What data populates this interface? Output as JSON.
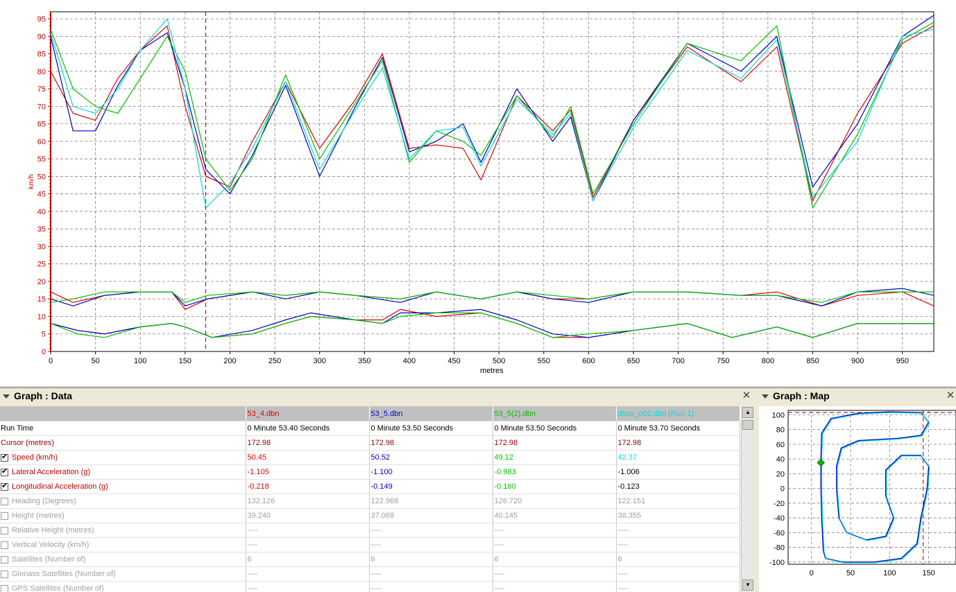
{
  "chart_data": {
    "type": "line",
    "xlabel": "metres",
    "ylabel": "km/h",
    "xlim": [
      0,
      985
    ],
    "ylim": [
      0,
      97
    ],
    "xticks": [
      0,
      50,
      100,
      150,
      200,
      250,
      300,
      350,
      400,
      450,
      500,
      550,
      600,
      650,
      700,
      750,
      800,
      850,
      900,
      950
    ],
    "yticks": [
      0,
      5,
      10,
      15,
      20,
      25,
      30,
      35,
      40,
      45,
      50,
      55,
      60,
      65,
      70,
      75,
      80,
      85,
      90,
      95
    ],
    "cursor_x": 173,
    "grid": true,
    "series": [
      {
        "name": "53_4.dbn",
        "color": "#e00000",
        "x": [
          0,
          25,
          50,
          75,
          100,
          130,
          150,
          173,
          200,
          225,
          262,
          300,
          340,
          370,
          400,
          430,
          460,
          480,
          520,
          560,
          580,
          605,
          650,
          710,
          770,
          810,
          850,
          900,
          950,
          985
        ],
        "y": [
          80,
          68,
          66,
          78,
          86,
          93,
          70,
          50,
          47,
          60,
          77,
          58,
          72,
          85,
          58,
          59,
          58,
          49,
          73,
          63,
          69,
          44,
          66,
          87,
          77,
          87,
          43,
          68,
          88,
          93
        ]
      },
      {
        "name": "53_5.dbn",
        "color": "#0000c0",
        "x": [
          0,
          25,
          50,
          75,
          100,
          130,
          150,
          173,
          200,
          225,
          262,
          300,
          340,
          370,
          400,
          430,
          460,
          480,
          520,
          560,
          580,
          605,
          650,
          710,
          770,
          810,
          850,
          900,
          950,
          985
        ],
        "y": [
          90,
          63,
          63,
          76,
          86,
          91,
          75,
          52,
          45,
          56,
          76,
          50,
          70,
          84,
          57,
          60,
          65,
          54,
          75,
          60,
          67,
          43,
          66,
          88,
          80,
          90,
          47,
          65,
          90,
          96
        ]
      },
      {
        "name": "53_5(2).dbn",
        "color": "#00c000",
        "x": [
          0,
          25,
          50,
          75,
          100,
          130,
          150,
          173,
          200,
          225,
          262,
          300,
          340,
          370,
          400,
          430,
          460,
          480,
          520,
          560,
          580,
          605,
          650,
          710,
          770,
          810,
          850,
          900,
          950,
          985
        ],
        "y": [
          92,
          75,
          70,
          68,
          78,
          90,
          80,
          55,
          46,
          55,
          79,
          55,
          71,
          83,
          54,
          63,
          60,
          56,
          73,
          61,
          70,
          45,
          65,
          88,
          83,
          93,
          41,
          62,
          89,
          94
        ]
      },
      {
        "name": "dbox_001.dbn (Run 1)",
        "color": "#00dcdc",
        "x": [
          0,
          25,
          50,
          75,
          100,
          130,
          150,
          173,
          200,
          225,
          262,
          300,
          340,
          370,
          400,
          430,
          460,
          480,
          520,
          560,
          580,
          605,
          650,
          710,
          770,
          810,
          850,
          900,
          950,
          985
        ],
        "y": [
          91,
          70,
          68,
          75,
          86,
          95,
          75,
          41,
          48,
          58,
          77,
          52,
          69,
          81,
          55,
          63,
          64,
          53,
          72,
          62,
          68,
          43,
          64,
          86,
          78,
          89,
          44,
          60,
          90,
          92
        ]
      },
      {
        "name": "53_4.dbn",
        "color": "#e00000",
        "x": [
          0,
          25,
          60,
          100,
          135,
          150,
          175,
          225,
          262,
          300,
          340,
          390,
          430,
          480,
          520,
          560,
          600,
          650,
          710,
          770,
          810,
          860,
          900,
          950,
          985
        ],
        "y": [
          17,
          14,
          16,
          17,
          17,
          12,
          15,
          17,
          16,
          17,
          16,
          15,
          17,
          15,
          17,
          15,
          15,
          17,
          17,
          16,
          17,
          13,
          16,
          17,
          13
        ]
      },
      {
        "name": "53_5.dbn",
        "color": "#0000c0",
        "x": [
          0,
          25,
          60,
          100,
          135,
          150,
          175,
          225,
          262,
          300,
          340,
          390,
          430,
          480,
          520,
          560,
          600,
          650,
          710,
          770,
          810,
          860,
          900,
          950,
          985
        ],
        "y": [
          15,
          13,
          16,
          17,
          17,
          13,
          15,
          17,
          15,
          17,
          16,
          14,
          17,
          15,
          17,
          15,
          14,
          17,
          17,
          16,
          16,
          13,
          17,
          18,
          16
        ]
      },
      {
        "name": "53_5(2).dbn",
        "color": "#00c000",
        "x": [
          0,
          25,
          60,
          100,
          135,
          150,
          175,
          225,
          262,
          300,
          340,
          390,
          430,
          480,
          520,
          560,
          600,
          650,
          710,
          770,
          810,
          860,
          900,
          950,
          985
        ],
        "y": [
          14,
          15,
          17,
          17,
          17,
          14,
          16,
          17,
          16,
          17,
          16,
          15,
          17,
          15,
          17,
          16,
          15,
          17,
          17,
          16,
          16,
          14,
          17,
          17,
          17
        ]
      },
      {
        "name": "53_4.dbn",
        "color": "#e00000",
        "x": [
          0,
          30,
          60,
          100,
          135,
          150,
          180,
          225,
          262,
          290,
          340,
          370,
          390,
          430,
          480,
          520,
          560,
          600,
          650,
          710,
          760,
          810,
          850,
          900,
          950,
          985
        ],
        "y": [
          8,
          6,
          5,
          7,
          8,
          7,
          4,
          5,
          8,
          10,
          9,
          9,
          12,
          10,
          11,
          8,
          4,
          4,
          6,
          8,
          4,
          7,
          4,
          8,
          8,
          8
        ]
      },
      {
        "name": "53_5.dbn",
        "color": "#0000c0",
        "x": [
          0,
          30,
          60,
          100,
          135,
          150,
          180,
          225,
          262,
          290,
          340,
          370,
          390,
          430,
          480,
          520,
          560,
          600,
          650,
          710,
          760,
          810,
          850,
          900,
          950,
          985
        ],
        "y": [
          8,
          6,
          5,
          7,
          8,
          7,
          4,
          6,
          9,
          11,
          9,
          8,
          11,
          11,
          12,
          9,
          5,
          4,
          6,
          8,
          4,
          7,
          4,
          8,
          8,
          8
        ]
      },
      {
        "name": "53_5(2).dbn",
        "color": "#00c000",
        "x": [
          0,
          30,
          60,
          100,
          135,
          150,
          180,
          225,
          262,
          290,
          340,
          370,
          390,
          430,
          480,
          520,
          560,
          600,
          650,
          710,
          760,
          810,
          850,
          900,
          950,
          985
        ],
        "y": [
          8,
          5,
          4,
          7,
          8,
          7,
          4,
          5,
          8,
          10,
          9,
          8,
          10,
          11,
          11,
          8,
          4,
          5,
          6,
          8,
          4,
          7,
          4,
          8,
          8,
          8
        ]
      }
    ]
  },
  "data_panel": {
    "title": "Graph : Data",
    "close": "✕",
    "files": [
      {
        "name": "53_4.dbn",
        "color": "#e00000"
      },
      {
        "name": "53_5.dbn",
        "color": "#0000c0"
      },
      {
        "name": "53_5(2).dbn",
        "color": "#00c000"
      },
      {
        "name": "dbox_001.dbn (Run 1)",
        "color": "#00dcdc"
      }
    ],
    "rows": [
      {
        "label": "Run Time",
        "checkbox": "none",
        "color": "#000000",
        "values": [
          "0 Minute 53.40 Seconds",
          "0 Minute 53.50 Seconds",
          "0 Minute 53.50 Seconds",
          "0 Minute 53.70 Seconds"
        ],
        "value_colors": [
          "#000000",
          "#000000",
          "#000000",
          "#000000"
        ]
      },
      {
        "label": "Cursor (metres)",
        "checkbox": "none",
        "color": "#900000",
        "values": [
          "172.98",
          "172.98",
          "172.98",
          "172.98"
        ],
        "value_colors": [
          "#900000",
          "#900000",
          "#900000",
          "#900000"
        ]
      },
      {
        "label": "Speed (km/h)",
        "checkbox": "on",
        "color": "#c00000",
        "values": [
          "50.45",
          "50.52",
          "49.12",
          "42.37"
        ],
        "value_colors": [
          "#e00000",
          "#0000c0",
          "#00c000",
          "#00dcdc"
        ]
      },
      {
        "label": "Lateral Acceleration (g)",
        "checkbox": "on",
        "color": "#c00000",
        "values": [
          "-1.105",
          "-1.100",
          "-0.983",
          "-1.006"
        ],
        "value_colors": [
          "#e00000",
          "#0000c0",
          "#00c000",
          "#000000"
        ]
      },
      {
        "label": "Longitudinal Acceleration (g)",
        "checkbox": "on",
        "color": "#c00000",
        "values": [
          "-0.218",
          "-0.149",
          "-0.160",
          "-0.123"
        ],
        "value_colors": [
          "#e00000",
          "#0000c0",
          "#00c000",
          "#000000"
        ]
      },
      {
        "label": "Heading (Degrees)",
        "checkbox": "off",
        "color": "#a0a0a0",
        "values": [
          "132.126",
          "122.968",
          "126.720",
          "122.151"
        ],
        "value_colors": [
          "#a0a0a0",
          "#a0a0a0",
          "#a0a0a0",
          "#a0a0a0"
        ]
      },
      {
        "label": "Height (metres)",
        "checkbox": "off",
        "color": "#a0a0a0",
        "values": [
          "39.240",
          "37.068",
          "40.145",
          "38.355"
        ],
        "value_colors": [
          "#a0a0a0",
          "#a0a0a0",
          "#a0a0a0",
          "#a0a0a0"
        ]
      },
      {
        "label": "Relative Height (metres)",
        "checkbox": "off",
        "color": "#a0a0a0",
        "values": [
          "----",
          "----",
          "----",
          "----"
        ],
        "value_colors": [
          "#a0a0a0",
          "#a0a0a0",
          "#a0a0a0",
          "#a0a0a0"
        ]
      },
      {
        "label": "Vertical Velocity (km/h)",
        "checkbox": "off",
        "color": "#a0a0a0",
        "values": [
          "----",
          "----",
          "----",
          "----"
        ],
        "value_colors": [
          "#a0a0a0",
          "#a0a0a0",
          "#a0a0a0",
          "#a0a0a0"
        ]
      },
      {
        "label": "Satellites (Number of)",
        "checkbox": "off",
        "color": "#a0a0a0",
        "values": [
          "6",
          "6",
          "6",
          "6"
        ],
        "value_colors": [
          "#a0a0a0",
          "#a0a0a0",
          "#a0a0a0",
          "#a0a0a0"
        ]
      },
      {
        "label": "Glonass Satellites (Number of)",
        "checkbox": "off",
        "color": "#a0a0a0",
        "values": [
          "----",
          "----",
          "----",
          "----"
        ],
        "value_colors": [
          "#a0a0a0",
          "#a0a0a0",
          "#a0a0a0",
          "#a0a0a0"
        ]
      },
      {
        "label": "GPS Satellites (Number of)",
        "checkbox": "off",
        "color": "#a0a0a0",
        "values": [
          "----",
          "----",
          "----",
          "----"
        ],
        "value_colors": [
          "#a0a0a0",
          "#a0a0a0",
          "#a0a0a0",
          "#a0a0a0"
        ]
      }
    ]
  },
  "map_panel": {
    "title": "Graph : Map",
    "close": "✕",
    "xticks": [
      0,
      50,
      100,
      150
    ],
    "yticks": [
      100,
      80,
      60,
      40,
      20,
      0,
      -20,
      -40,
      -60,
      -80,
      -100
    ],
    "xlim": [
      -30,
      185
    ],
    "ylim": [
      -103,
      106
    ],
    "cursor_point": [
      12,
      35
    ],
    "track": [
      [
        15,
        -85
      ],
      [
        13,
        -40
      ],
      [
        12,
        0
      ],
      [
        12,
        40
      ],
      [
        13,
        75
      ],
      [
        25,
        95
      ],
      [
        60,
        102
      ],
      [
        100,
        104
      ],
      [
        140,
        103
      ],
      [
        150,
        90
      ],
      [
        140,
        72
      ],
      [
        110,
        68
      ],
      [
        60,
        65
      ],
      [
        38,
        55
      ],
      [
        32,
        30
      ],
      [
        32,
        0
      ],
      [
        35,
        -40
      ],
      [
        45,
        -60
      ],
      [
        70,
        -70
      ],
      [
        95,
        -65
      ],
      [
        105,
        -40
      ],
      [
        95,
        -10
      ],
      [
        95,
        25
      ],
      [
        115,
        45
      ],
      [
        140,
        45
      ],
      [
        150,
        30
      ],
      [
        148,
        0
      ],
      [
        140,
        -40
      ],
      [
        135,
        -75
      ],
      [
        115,
        -95
      ],
      [
        80,
        -100
      ],
      [
        40,
        -100
      ],
      [
        18,
        -95
      ],
      [
        15,
        -85
      ]
    ]
  }
}
